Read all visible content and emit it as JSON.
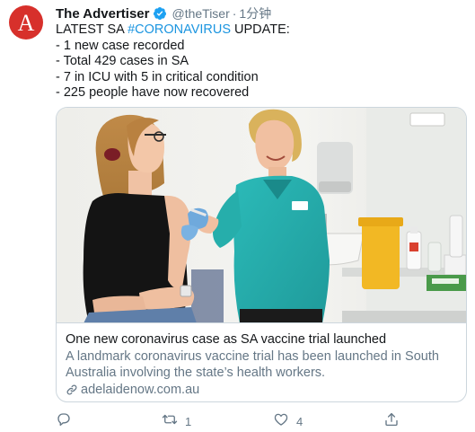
{
  "tweet": {
    "avatar_letter": "A",
    "display_name": "The Advertiser",
    "handle": "@theTiser",
    "separator": "·",
    "timestamp": "1分钟",
    "text": {
      "line1_prefix": "LATEST SA ",
      "line1_hashtag": "#CORONAVIRUS",
      "line1_suffix": " UPDATE:",
      "lines": [
        "-  1 new case recorded",
        "- Total 429 cases in SA",
        "- 7 in ICU with 5 in critical condition",
        "- 225 people have now recovered"
      ]
    }
  },
  "card": {
    "title": "One new coronavirus case as SA vaccine trial launched",
    "description": "A landmark coronavirus vaccine trial has been launched in South Australia involving the state’s health workers.",
    "domain": "adelaidenow.com.au"
  },
  "actions": {
    "reply_count": "",
    "retweet_count": "1",
    "like_count": "4",
    "share_count": ""
  },
  "colors": {
    "brand_red": "#d7302b",
    "link_blue": "#1b95e0",
    "verified_blue": "#1da1f2",
    "secondary_text": "#657786",
    "border": "#ccd6dd"
  },
  "icons": {
    "verified": "verified-badge-icon",
    "link": "link-icon",
    "reply": "reply-icon",
    "retweet": "retweet-icon",
    "like": "heart-icon",
    "share": "share-icon"
  }
}
